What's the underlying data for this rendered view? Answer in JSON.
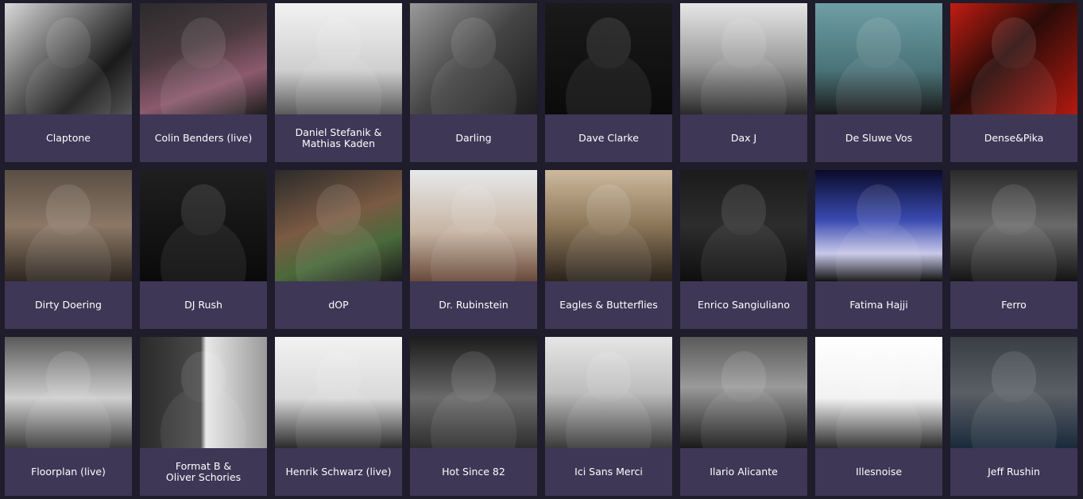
{
  "artists": [
    {
      "name": "Claptone",
      "photo_bg": "linear-gradient(135deg,#d9d9d9 0%,#777 35%,#1a1a1a 70%,#555 100%)"
    },
    {
      "name": "Colin Benders (live)",
      "photo_bg": "linear-gradient(160deg,#2b2b2b 0%,#4a3a3f 40%,#8c5a6d 70%,#1d1d1d 100%)"
    },
    {
      "name": "Daniel Stefanik & Mathias Kaden",
      "photo_bg": "linear-gradient(180deg,#f2f2f2 0%,#cfcfcf 60%,#5a5a5a 100%)"
    },
    {
      "name": "Darling",
      "photo_bg": "linear-gradient(135deg,#9a9a9a 0%,#444 50%,#1c1c1c 100%)"
    },
    {
      "name": "Dave Clarke",
      "photo_bg": "linear-gradient(180deg,#1a1a1a 0%,#0b0b0b 100%)"
    },
    {
      "name": "Dax J",
      "photo_bg": "linear-gradient(180deg,#e6e6e6 0%,#9a9a9a 55%,#2a2a2a 100%)"
    },
    {
      "name": "De Sluwe Vos",
      "photo_bg": "linear-gradient(180deg,#6e9ea4 0%,#4a7378 60%,#1a1a1a 100%)"
    },
    {
      "name": "Dense&Pika",
      "photo_bg": "linear-gradient(135deg,#c21d12 0%,#2a0b08 45%,#b31a10 100%)"
    },
    {
      "name": "Dirty Doering",
      "photo_bg": "linear-gradient(180deg,#5a4e44 0%,#8b7866 50%,#2e2620 100%)"
    },
    {
      "name": "DJ Rush",
      "photo_bg": "linear-gradient(180deg,#1f1f1f 0%,#0a0a0a 100%)"
    },
    {
      "name": "dOP",
      "photo_bg": "linear-gradient(160deg,#2a2a2a 0%,#7a5a42 45%,#4a6a3a 70%,#1a1a1a 100%)"
    },
    {
      "name": "Dr. Rubinstein",
      "photo_bg": "linear-gradient(180deg,#e7e9eb 0%,#c7b5a3 55%,#6a4a3a 100%)"
    },
    {
      "name": "Eagles & Butterflies",
      "photo_bg": "linear-gradient(180deg,#cdb99d 0%,#8c7658 50%,#2a231b 100%)"
    },
    {
      "name": "Enrico Sangiuliano",
      "photo_bg": "linear-gradient(180deg,#1b1b1b 0%,#2d2d2d 50%,#0e0e0e 100%)"
    },
    {
      "name": "Fatima Hajji",
      "photo_bg": "linear-gradient(180deg,#0a0a2a 0%,#3a4bb0 45%,#c8c8e8 75%,#111 100%)"
    },
    {
      "name": "Ferro",
      "photo_bg": "linear-gradient(180deg,#2a2a2a 0%,#6a6a6a 50%,#141414 100%)"
    },
    {
      "name": "Floorplan (live)",
      "photo_bg": "linear-gradient(180deg,#5a5a5a 0%,#cfcfcf 55%,#3a3a3a 100%)"
    },
    {
      "name": "Format B  &\nOliver Schories",
      "photo_bg": "linear-gradient(90deg,#2a2a2a 0%,#4a4a4a 48%,#e8e8e8 52%,#9a9a9a 100%)"
    },
    {
      "name": "Henrik Schwarz (live)",
      "photo_bg": "linear-gradient(180deg,#f2f2f2 0%,#d9d9d9 55%,#2a2a2a 100%)"
    },
    {
      "name": "Hot Since 82",
      "photo_bg": "linear-gradient(180deg,#1c1c1c 0%,#6a6a6a 55%,#2e2e2e 100%)"
    },
    {
      "name": "Ici Sans Merci",
      "photo_bg": "linear-gradient(180deg,#e6e6e6 0%,#bdbdbd 50%,#3a3a3a 100%)"
    },
    {
      "name": "Ilario Alicante",
      "photo_bg": "linear-gradient(180deg,#5a5a5a 0%,#9a9a9a 45%,#1a1a1a 100%)"
    },
    {
      "name": "Illesnoise",
      "photo_bg": "linear-gradient(180deg,#ffffff 0%,#f2f2f2 55%,#2a2a2a 100%)"
    },
    {
      "name": "Jeff Rushin",
      "photo_bg": "linear-gradient(180deg,#3a3e44 0%,#5a5f66 50%,#1a2a3a 100%)"
    }
  ],
  "colors": {
    "page_background": "#1f1c2b",
    "name_bar": "#3e3756",
    "name_text": "#ffffff"
  }
}
